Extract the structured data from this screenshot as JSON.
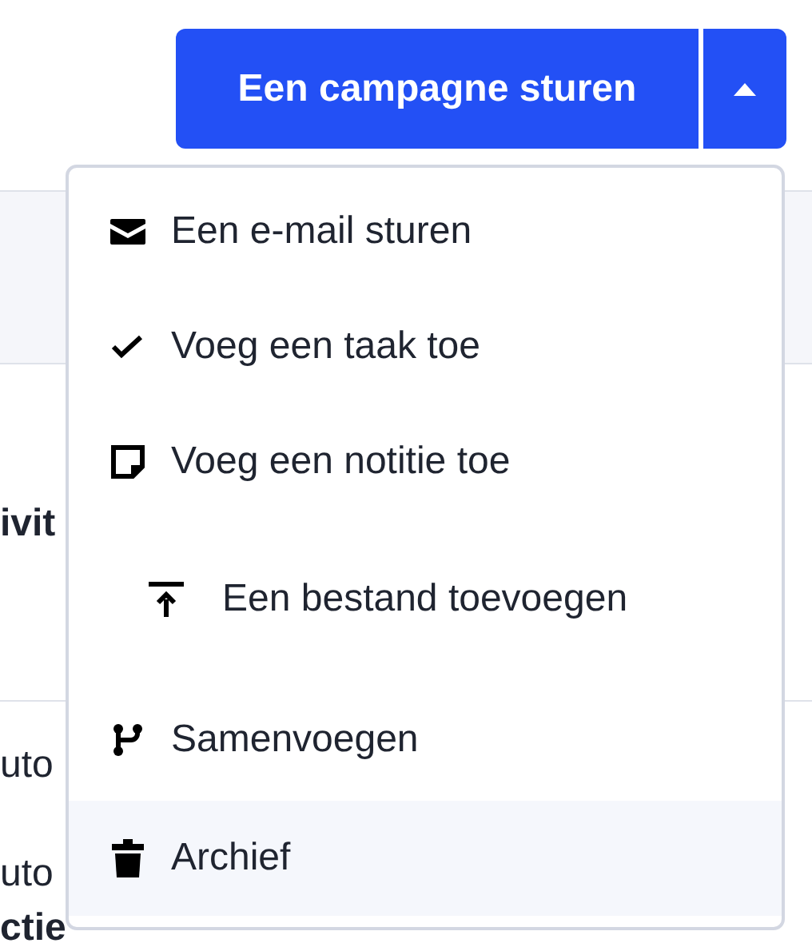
{
  "campaign_button": {
    "label": "Een campagne sturen",
    "menu_open": true
  },
  "background": [
    {
      "kind": "heading",
      "text": "ivit"
    },
    {
      "kind": "plain",
      "text": "uto"
    },
    {
      "kind": "plain",
      "text": "uto"
    },
    {
      "kind": "heading",
      "text": "ctie"
    }
  ],
  "menu": [
    {
      "kind": "email",
      "label": "Een e-mail sturen",
      "highlighted": false
    },
    {
      "kind": "task",
      "label": "Voeg een taak toe",
      "highlighted": false
    },
    {
      "kind": "note",
      "label": "Voeg een notitie toe",
      "highlighted": false
    },
    {
      "kind": "upload",
      "label": "Een bestand toevoegen",
      "highlighted": false
    },
    {
      "kind": "merge",
      "label": "Samenvoegen",
      "highlighted": false
    },
    {
      "kind": "archive",
      "label": "Archief",
      "highlighted": true
    }
  ]
}
